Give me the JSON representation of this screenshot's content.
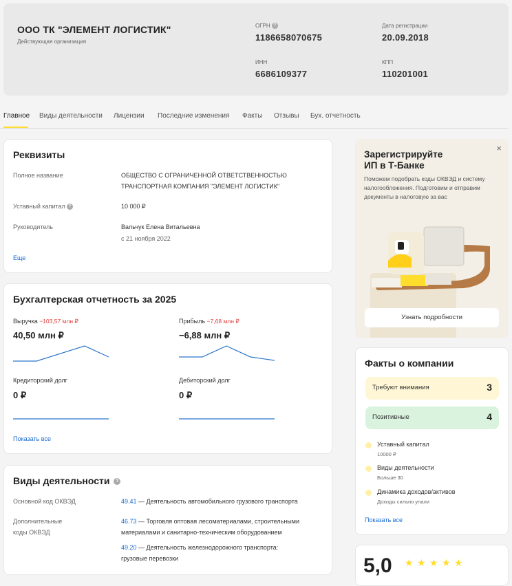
{
  "header": {
    "company_name": "ООО ТК \"ЭЛЕМЕНТ ЛОГИСТИК\"",
    "status": "Действующая организация",
    "ogrn_label": "ОГРН",
    "ogrn_value": "1186658070675",
    "reg_date_label": "Дата регистрации",
    "reg_date_value": "20.09.2018",
    "inn_label": "ИНН",
    "inn_value": "6686109377",
    "kpp_label": "КПП",
    "kpp_value": "110201001"
  },
  "tabs": [
    {
      "label": "Главное",
      "active": true
    },
    {
      "label": "Виды деятельности"
    },
    {
      "label": "Лицензии"
    },
    {
      "label": "Последние изменения"
    },
    {
      "label": "Факты"
    },
    {
      "label": "Отзывы"
    },
    {
      "label": "Бух. отчетность"
    }
  ],
  "requisites": {
    "title": "Реквизиты",
    "full_name_label": "Полное название",
    "full_name_line1": "ОБЩЕСТВО С ОГРАНИЧЕННОЙ ОТВЕТСТВЕННОСТЬЮ",
    "full_name_line2": "ТРАНСПОРТНАЯ КОМПАНИЯ \"ЭЛЕМЕНТ ЛОГИСТИК\"",
    "capital_label": "Уставный капитал",
    "capital_value": "10 000 ₽",
    "head_label": "Руководитель",
    "head_name": "Вальчук Елена Витальевна",
    "head_since": "с 21 ноября 2022",
    "more_link": "Еще"
  },
  "accounting": {
    "title": "Бухгалтерская отчетность за 2025",
    "revenue_label": "Выручка",
    "revenue_change": "−103,57 млн ₽",
    "revenue_value": "40,50 млн ₽",
    "profit_label": "Прибыль",
    "profit_change": "−7,68 млн ₽",
    "profit_value": "−6,88 млн ₽",
    "creditor_label": "Кредиторский долг",
    "creditor_value": "0 ₽",
    "debtor_label": "Дебиторский долг",
    "debtor_value": "0 ₽",
    "show_all": "Показать все",
    "line_color": "#2a73c9"
  },
  "activities": {
    "title": "Виды деятельности",
    "main_label": "Основной код ОКВЭД",
    "main_code": "49.41",
    "main_text": " — Деятельность автомобильного грузового транспорта",
    "extra_label_line1": "Дополнительные",
    "extra_label_line2": "коды ОКВЭД",
    "extra1_code": "46.73",
    "extra1_line1": " — Торговля оптовая лесоматериалами, строительными",
    "extra1_line2": "материалами и санитарно-техническим оборудованием",
    "extra2_code": "49.20",
    "extra2_line1": " — Деятельность железнодорожного транспорта:",
    "extra2_line2": "грузовые перевозки"
  },
  "promo": {
    "title_line1": "Зарегистрируйте",
    "title_line2": "ИП в Т-Банке",
    "text": "Поможем подобрать коды ОКВЭД и систему налогообложения. Подготовим и отправим документы в налоговую за вас",
    "button": "Узнать подробности",
    "close": "×"
  },
  "facts": {
    "title": "Факты о компании",
    "attention_label": "Требуют внимания",
    "attention_count": "3",
    "positive_label": "Позитивные",
    "positive_count": "4",
    "items": [
      {
        "title": "Уставный капитал",
        "sub": "10000 ₽"
      },
      {
        "title": "Виды деятельности",
        "sub": "Больше 30"
      },
      {
        "title": "Динамика доходов/активов",
        "sub": "Доходы сильно упали"
      }
    ],
    "show_all": "Показать все"
  },
  "rating": {
    "value": "5,0"
  }
}
